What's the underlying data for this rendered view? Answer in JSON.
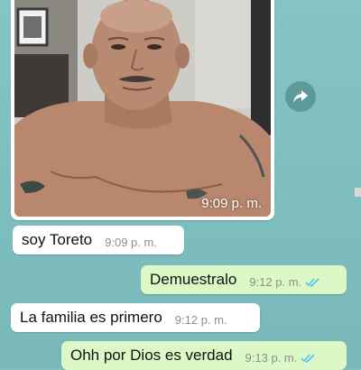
{
  "chat": {
    "image_message": {
      "time": "9:09 p. m."
    },
    "messages": [
      {
        "text": "soy Toreto",
        "time": "9:09 p. m."
      },
      {
        "text": "Demuestralo",
        "time": "9:12 p. m."
      },
      {
        "text": "La familia es primero",
        "time": "9:12 p. m."
      },
      {
        "text": "Ohh por Dios es verdad",
        "time": "9:13 p. m."
      }
    ],
    "icons": {
      "forward": "forward-arrow-icon",
      "read_receipt": "double-check-icon"
    },
    "colors": {
      "background": "#7fbfc0",
      "incoming_bubble": "#ffffff",
      "outgoing_bubble": "#dcf8c6",
      "read_ticks": "#4fc3f7"
    }
  }
}
